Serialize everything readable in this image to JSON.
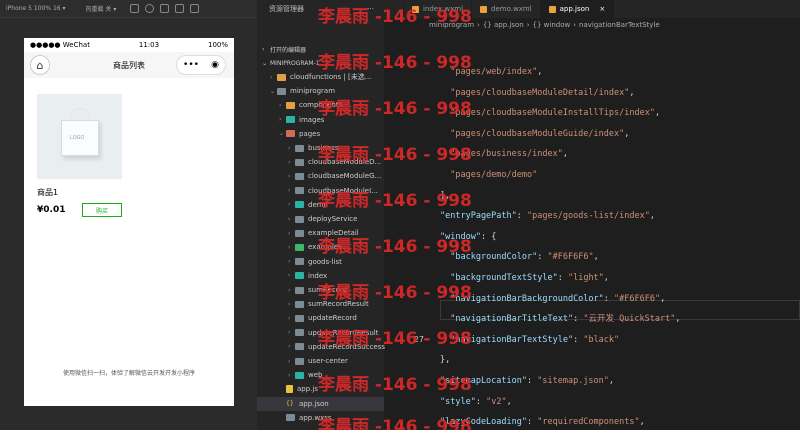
{
  "simulator": {
    "device_label": "iPhone 5 100% 16 ▾",
    "mode_label": "热重载 关 ▾",
    "status": {
      "carrier": "●●●●● WeChat",
      "time": "11:03",
      "battery": "100%"
    },
    "nav_title": "商品列表",
    "capsule_dots": "•••",
    "product": {
      "image_text": "LOGO",
      "name": "商品1",
      "price": "¥0.01",
      "buy_label": "购买"
    },
    "footer": "使用微信扫一扫，体验了解微信云开发开发小程序"
  },
  "explorer": {
    "title": "资源管理器",
    "more": "···",
    "open_editors": "打开的编辑器",
    "project": "MINIPROGRAM-1",
    "tree": [
      {
        "label": "cloudfunctions | [未选...",
        "indent": 1,
        "icon": "orange",
        "chev": "›"
      },
      {
        "label": "miniprogram",
        "indent": 1,
        "icon": "grey",
        "chev": "⌄"
      },
      {
        "label": "components",
        "indent": 2,
        "icon": "orange",
        "chev": "›"
      },
      {
        "label": "images",
        "indent": 2,
        "icon": "teal",
        "chev": "›"
      },
      {
        "label": "pages",
        "indent": 2,
        "icon": "red",
        "chev": "⌄"
      },
      {
        "label": "business",
        "indent": 3,
        "icon": "grey",
        "chev": "›"
      },
      {
        "label": "cloudbaseModuleD...",
        "indent": 3,
        "icon": "grey",
        "chev": "›"
      },
      {
        "label": "cloudbaseModuleG...",
        "indent": 3,
        "icon": "grey",
        "chev": "›"
      },
      {
        "label": "cloudbaseModuleI...",
        "indent": 3,
        "icon": "grey",
        "chev": "›"
      },
      {
        "label": "demo",
        "indent": 3,
        "icon": "teal",
        "chev": "›"
      },
      {
        "label": "deployService",
        "indent": 3,
        "icon": "grey",
        "chev": "›"
      },
      {
        "label": "exampleDetail",
        "indent": 3,
        "icon": "grey",
        "chev": "›"
      },
      {
        "label": "examples",
        "indent": 3,
        "icon": "green",
        "chev": "›"
      },
      {
        "label": "goods-list",
        "indent": 3,
        "icon": "grey",
        "chev": "›"
      },
      {
        "label": "index",
        "indent": 3,
        "icon": "teal",
        "chev": "›"
      },
      {
        "label": "sumRecord",
        "indent": 3,
        "icon": "grey",
        "chev": "›"
      },
      {
        "label": "sumRecordResult",
        "indent": 3,
        "icon": "grey",
        "chev": "›"
      },
      {
        "label": "updateRecord",
        "indent": 3,
        "icon": "grey",
        "chev": "›"
      },
      {
        "label": "updateRecordResult",
        "indent": 3,
        "icon": "grey",
        "chev": "›"
      },
      {
        "label": "updateRecordSuccess",
        "indent": 3,
        "icon": "grey",
        "chev": "›"
      },
      {
        "label": "user-center",
        "indent": 3,
        "icon": "grey",
        "chev": "›"
      },
      {
        "label": "web",
        "indent": 3,
        "icon": "teal",
        "chev": "›"
      },
      {
        "label": "app.js",
        "indent": 2,
        "icon": "js",
        "chev": ""
      },
      {
        "label": "app.json",
        "indent": 2,
        "icon": "json",
        "chev": "",
        "selected": true
      },
      {
        "label": "app.wxss",
        "indent": 2,
        "icon": "grey",
        "chev": ""
      }
    ]
  },
  "tabs": [
    {
      "label": "index.wxml",
      "active": false
    },
    {
      "label": "demo.wxml",
      "active": false
    },
    {
      "label": "app.json",
      "active": true
    }
  ],
  "breadcrumb": [
    "miniprogram",
    "›",
    "{} app.json",
    "›",
    "{} window",
    "›",
    "navigationBarTextStyle"
  ],
  "code_lines": [
    {
      "text": "  \"pages/web/index\",",
      "ln": ""
    },
    {
      "text": "  \"pages/cloudbaseModuleDetail/index\",",
      "ln": ""
    },
    {
      "text": "  \"pages/cloudbaseModuleInstallTips/index\",",
      "ln": ""
    },
    {
      "text": "  \"pages/cloudbaseModuleGuide/index\",",
      "ln": ""
    },
    {
      "text": "  \"pages/business/index\",",
      "ln": ""
    },
    {
      "text": "  \"pages/demo/demo\"",
      "ln": ""
    },
    {
      "text": "],",
      "ln": ""
    },
    {
      "text": "\"entryPagePath\": \"pages/goods-list/index\",",
      "ln": ""
    },
    {
      "text": "\"window\": {",
      "ln": ""
    },
    {
      "text": "  \"backgroundColor\": \"#F6F6F6\",",
      "ln": ""
    },
    {
      "text": "  \"backgroundTextStyle\": \"light\",",
      "ln": ""
    },
    {
      "text": "  \"navigationBarBackgroundColor\": \"#F6F6F6\",",
      "ln": ""
    },
    {
      "text": "  \"navigationBarTitleText\": \"云开发 QuickStart\",",
      "ln": ""
    },
    {
      "text": "  \"navigationBarTextStyle\": \"black\"",
      "ln": "27"
    },
    {
      "text": "},",
      "ln": ""
    },
    {
      "text": "\"sitemapLocation\": \"sitemap.json\",",
      "ln": ""
    },
    {
      "text": "\"style\": \"v2\",",
      "ln": ""
    },
    {
      "text": "\"lazyCodeLoading\": \"requiredComponents\",",
      "ln": ""
    },
    {
      "text": "\"tabBar\": {",
      "ln": ""
    }
  ],
  "watermark": "李晨雨 -146 - 998",
  "colors": {
    "accent": "#1aad19",
    "watermark": "#dc2828",
    "string": "#ce9178",
    "key": "#9cdcfe"
  }
}
